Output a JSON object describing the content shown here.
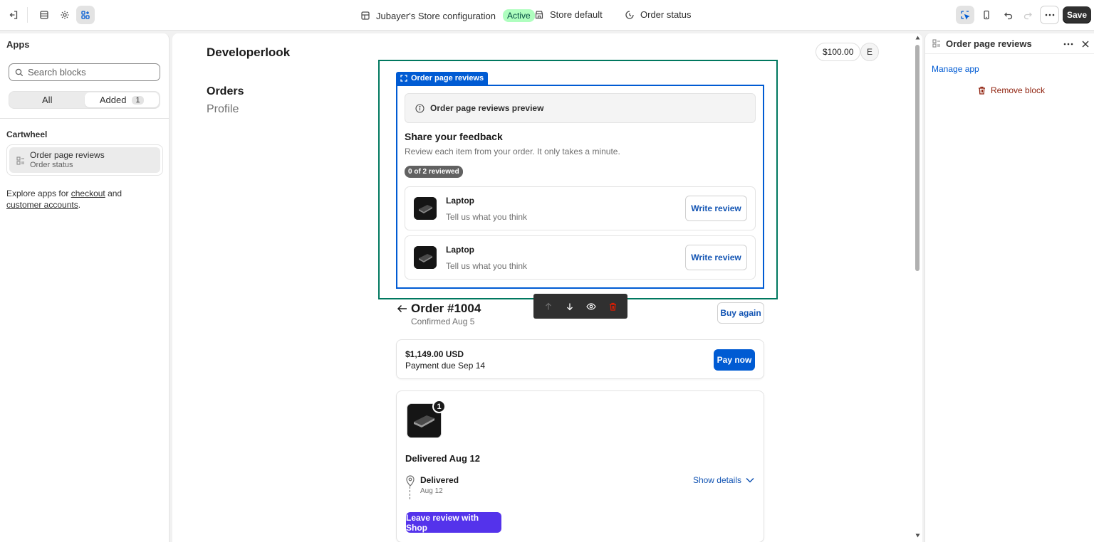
{
  "topbar": {
    "store_config": "Jubayer's Store configuration",
    "status_badge": "Active",
    "store_default": "Store default",
    "page": "Order status",
    "save_label": "Save"
  },
  "left_panel": {
    "title": "Apps",
    "search_placeholder": "Search blocks",
    "filter_all": "All",
    "filter_added": "Added",
    "added_count": "1",
    "group": "Cartwheel",
    "app_block_title": "Order page reviews",
    "app_block_sub": "Order status",
    "explore_prefix": "Explore apps for ",
    "explore_link1": "checkout",
    "explore_and": " and",
    "explore_link2": "customer accounts",
    "explore_suffix": "."
  },
  "preview": {
    "brand": "Developerlook",
    "nav_orders": "Orders",
    "nav_profile": "Profile",
    "amount": "$100.00",
    "avatar": "E",
    "block_tag": "Order page reviews",
    "info": "Order page reviews preview",
    "feedback_title": "Share your feedback",
    "feedback_sub": "Review each item from your order. It only takes a minute.",
    "reviewed": "0 of 2 reviewed",
    "products": [
      {
        "name": "Laptop",
        "sub": "Tell us what you think",
        "button": "Write review"
      },
      {
        "name": "Laptop",
        "sub": "Tell us what you think",
        "button": "Write review"
      }
    ],
    "order_title": "Order #1004",
    "order_confirmed": "Confirmed Aug 5",
    "buy_again": "Buy again",
    "payment_amount": "$1,149.00 USD",
    "payment_due": "Payment due Sep 14",
    "pay_now": "Pay now",
    "item_qty": "1",
    "delivered_title": "Delivered Aug 12",
    "delivery_status": "Delivered",
    "delivery_date": "Aug 12",
    "show_details": "Show details",
    "shop_button": "Leave review with Shop"
  },
  "right_panel": {
    "title": "Order page reviews",
    "manage_app": "Manage app",
    "remove_block": "Remove block"
  },
  "colors": {
    "accent_blue": "#005bd3",
    "frame_green": "#00785f",
    "shop_purple": "#5433eb",
    "active_badge": "#affebf",
    "danger": "#8e1f0b"
  }
}
